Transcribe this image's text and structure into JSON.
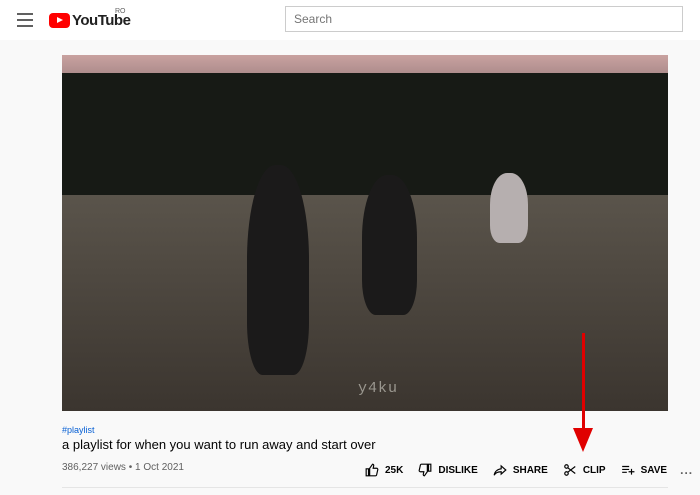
{
  "header": {
    "logo_text": "YouTube",
    "region": "RO",
    "search_placeholder": "Search"
  },
  "video": {
    "watermark": "y4ku",
    "hashtag": "#playlist",
    "title": "a playlist for when you want to run away and start over",
    "views": "386,227 views",
    "separator": "•",
    "date": "1 Oct 2021"
  },
  "actions": {
    "like": "25K",
    "dislike": "DISLIKE",
    "share": "SHARE",
    "clip": "CLIP",
    "save": "SAVE",
    "more": "..."
  },
  "colors": {
    "brand_red": "#ff0000",
    "arrow_red": "#e00000",
    "link_blue": "#065fd4"
  },
  "icons": [
    "menu-icon",
    "youtube-logo",
    "like-icon",
    "dislike-icon",
    "share-icon",
    "scissors-icon",
    "save-playlist-icon",
    "more-icon"
  ]
}
